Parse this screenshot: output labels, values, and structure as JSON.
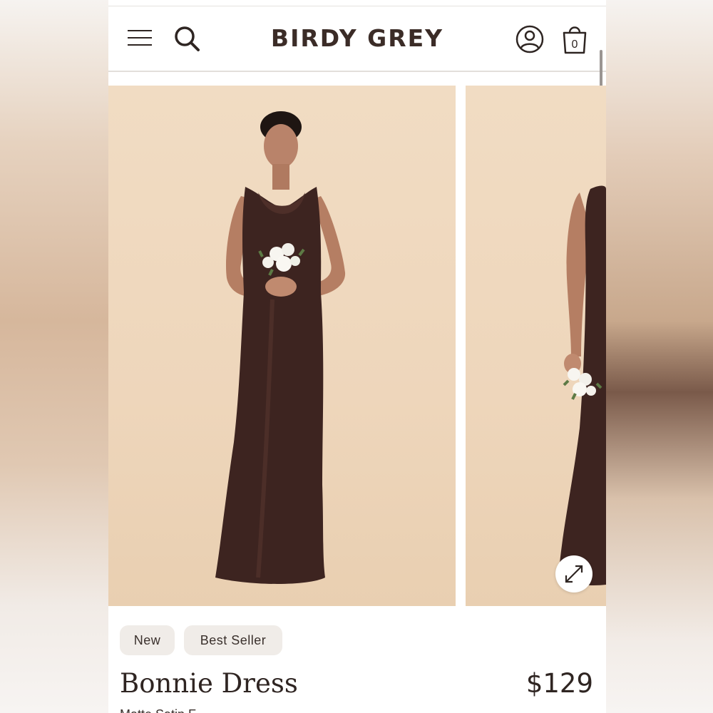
{
  "header": {
    "logo": "BIRDY GREY",
    "menu_icon": "hamburger-menu-icon",
    "search_icon": "search-icon",
    "account_icon": "account-icon",
    "bag_icon": "shopping-bag-icon",
    "bag_count": "0"
  },
  "gallery": {
    "images": [
      {
        "name": "model-front-photo",
        "dress_color": "#3d2420"
      },
      {
        "name": "model-side-photo",
        "dress_color": "#3d2420"
      }
    ],
    "expand_icon": "expand-arrows-icon"
  },
  "product": {
    "badges": [
      "New",
      "Best Seller"
    ],
    "name": "Bonnie Dress",
    "price": "$129",
    "subtitle": "Matte Satin F..."
  },
  "colors": {
    "text": "#2f2522",
    "backdrop": "#eed6bb",
    "badge_bg": "#f0ece8"
  }
}
